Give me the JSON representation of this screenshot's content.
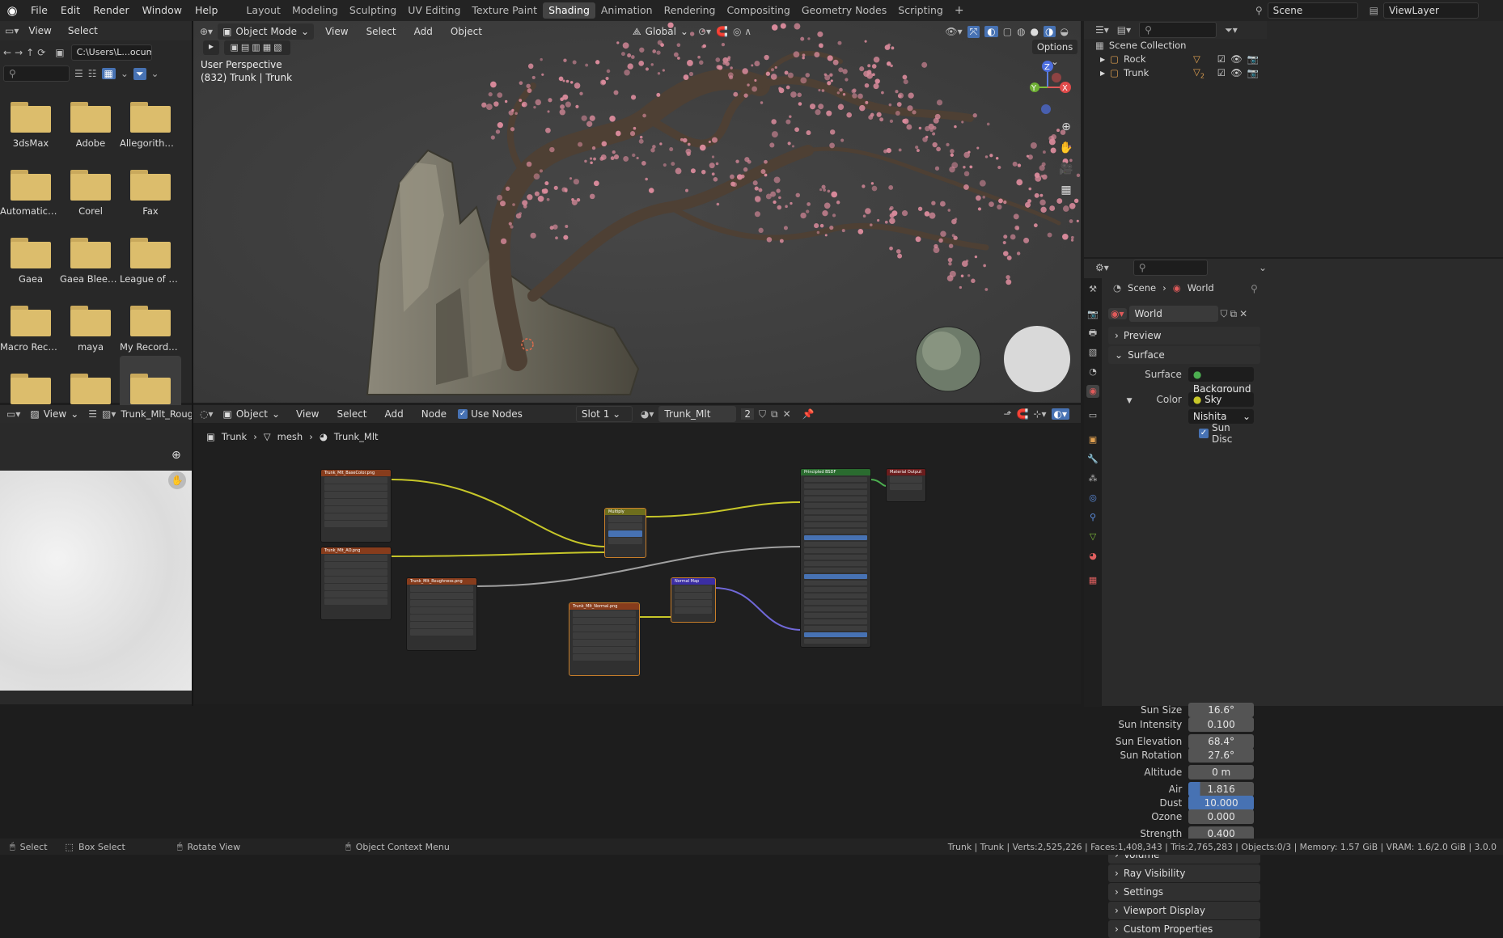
{
  "topbar": {
    "logo": "blender-logo-icon",
    "menus": [
      "File",
      "Edit",
      "Render",
      "Window",
      "Help"
    ],
    "workspaces": [
      "Layout",
      "Modeling",
      "Sculpting",
      "UV Editing",
      "Texture Paint",
      "Shading",
      "Animation",
      "Rendering",
      "Compositing",
      "Geometry Nodes",
      "Scripting"
    ],
    "active_workspace": "Shading",
    "add_tab": "+",
    "scene": "Scene",
    "view_layer": "ViewLayer"
  },
  "file_browser": {
    "header": {
      "view": "View",
      "select": "Select"
    },
    "path": "C:\\Users\\L...ocuments\\",
    "folders": [
      "3dsMax",
      "Adobe",
      "Allegorithmic",
      "AutomaticSol...",
      "Corel",
      "Fax",
      "Gaea",
      "Gaea Bleedin...",
      "League of Leg...",
      "Macro Record...",
      "maya",
      "My Recorded ...",
      "",
      "",
      ""
    ],
    "selected_index": 14
  },
  "viewport": {
    "mode": "Object Mode",
    "menus": [
      "View",
      "Select",
      "Add",
      "Object"
    ],
    "orientation": "Global",
    "options": "Options",
    "info_line1": "User Perspective",
    "info_line2": "(832) Trunk | Trunk",
    "axis": {
      "x": "X",
      "y": "Y",
      "z": "Z"
    }
  },
  "outliner": {
    "title": "Scene Collection",
    "items": [
      {
        "name": "Rock"
      },
      {
        "name": "Trunk"
      }
    ],
    "trunk_badge": "2"
  },
  "properties": {
    "breadcrumb": {
      "scene": "Scene",
      "world": "World"
    },
    "world_name": "World",
    "sections_top": [
      "Preview",
      "Surface"
    ],
    "surface": {
      "label": "Surface",
      "value": "Background"
    },
    "color": {
      "label": "Color",
      "value": "Sky Texture"
    },
    "sky_type": "Nishita",
    "sun_disc": "Sun Disc",
    "rows": [
      {
        "label": "Sun Size",
        "value": "16.6°"
      },
      {
        "label": "Sun Intensity",
        "value": "0.100"
      },
      {
        "label": "Sun Elevation",
        "value": "68.4°"
      },
      {
        "label": "Sun Rotation",
        "value": "27.6°"
      },
      {
        "label": "Altitude",
        "value": "0 m"
      },
      {
        "label": "Air",
        "value": "1.816",
        "fill": 0.18
      },
      {
        "label": "Dust",
        "value": "10.000",
        "fill": 1.0
      },
      {
        "label": "Ozone",
        "value": "0.000"
      },
      {
        "label": "Strength",
        "value": "0.400"
      }
    ],
    "sections_bottom": [
      "Volume",
      "Ray Visibility",
      "Settings",
      "Viewport Display",
      "Custom Properties"
    ]
  },
  "image_editor": {
    "view": "View",
    "image_name": "Trunk_Mlt_Roughn"
  },
  "node_editor": {
    "object": "Object",
    "menus": [
      "View",
      "Select",
      "Add",
      "Node"
    ],
    "use_nodes": "Use Nodes",
    "slot": "Slot 1",
    "material": "Trunk_Mlt",
    "users": "2",
    "breadcrumb": [
      "Trunk",
      "mesh",
      "Trunk_Mlt"
    ],
    "nodes": {
      "basecolor": "Trunk_Mlt_BaseColor.png",
      "ao": "Trunk_Mlt_AO.png",
      "roughness": "Trunk_Mlt_Roughness.png",
      "normal_tex": "Trunk_Mlt_Normal.png",
      "multiply": "Multiply",
      "normal_map": "Normal Map",
      "principled": "Principled BSDF",
      "output": "Material Output"
    }
  },
  "statusbar": {
    "select": "Select",
    "box_select": "Box Select",
    "rotate": "Rotate View",
    "context": "Object Context Menu",
    "stats": "Trunk | Trunk | Verts:2,525,226 | Faces:1,408,343 | Tris:2,765,283 | Objects:0/3 | Memory: 1.57 GiB | VRAM: 1.6/2.0 GiB | 3.0.0"
  },
  "colors": {
    "accent": "#4772b3",
    "node_tex": "#873c1c",
    "node_color": "#6e6e1d",
    "node_vector": "#3b2ea4",
    "node_shader": "#2a6b2f",
    "blossom": "#d98a9b"
  }
}
